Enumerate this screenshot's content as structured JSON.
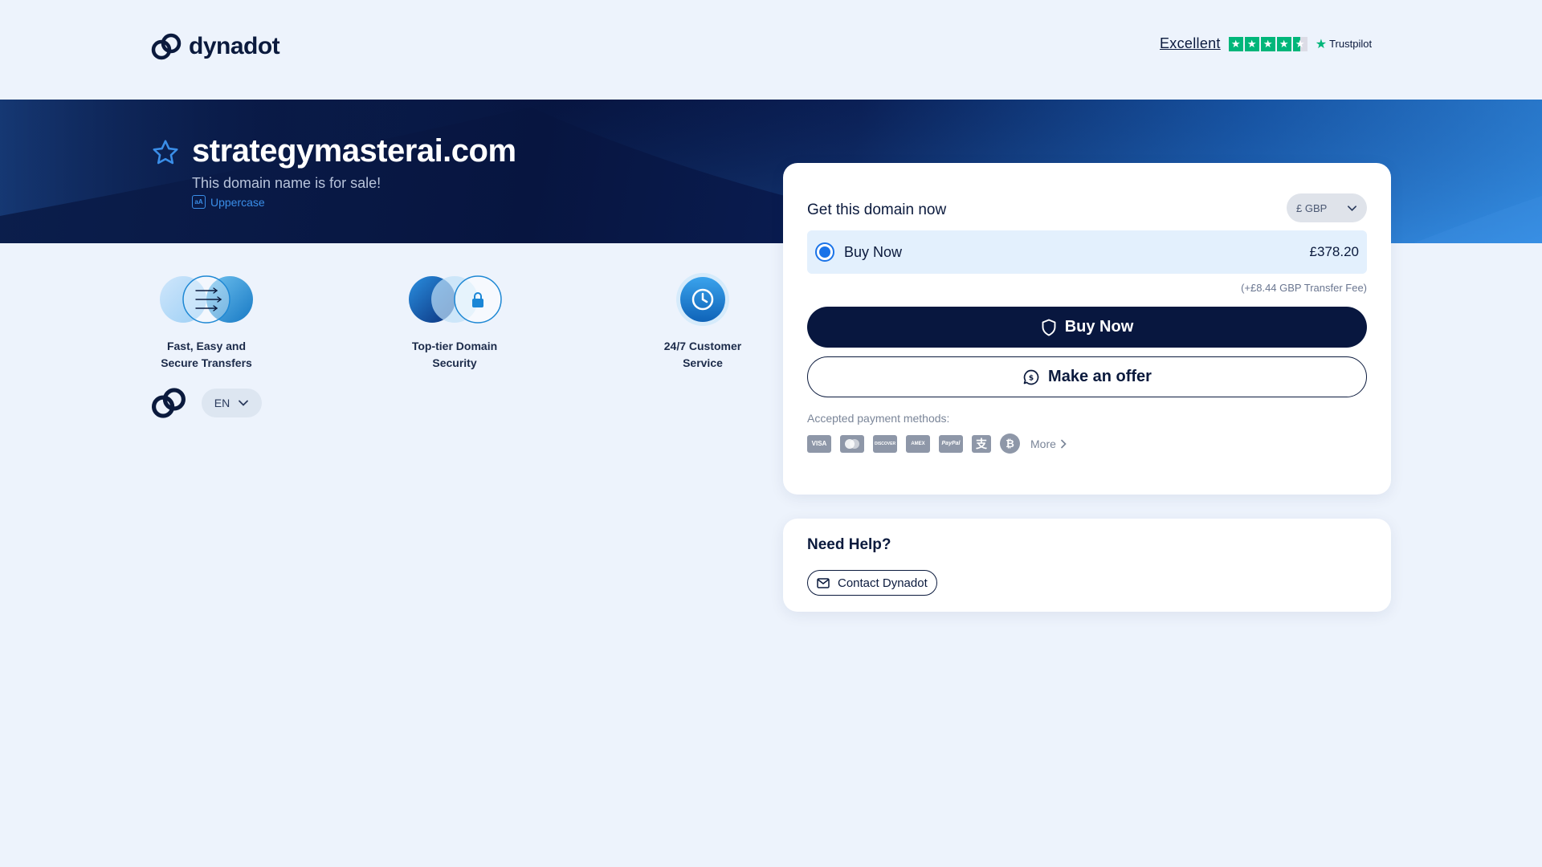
{
  "brand": {
    "name": "dynadot"
  },
  "trustpilot": {
    "rating_word": "Excellent",
    "brand": "Trustpilot",
    "stars": 4.5
  },
  "hero": {
    "domain": "strategymasterai.com",
    "subtitle": "This domain name is for sale!",
    "uppercase_label": "Uppercase",
    "uppercase_icon_text": "aA"
  },
  "features": [
    {
      "line1": "Fast, Easy and",
      "line2": "Secure Transfers",
      "icon": "transfer-icon"
    },
    {
      "line1": "Top-tier Domain",
      "line2": "Security",
      "icon": "lock-icon"
    },
    {
      "line1": "24/7 Customer",
      "line2": "Service",
      "icon": "clock-icon"
    }
  ],
  "language": {
    "selected": "EN"
  },
  "purchase": {
    "title": "Get this domain now",
    "currency": "£ GBP",
    "option_label": "Buy Now",
    "option_price": "£378.20",
    "transfer_fee": "(+£8.44 GBP Transfer Fee)",
    "buy_button": "Buy Now",
    "offer_button": "Make an offer",
    "payment_label": "Accepted payment methods:",
    "payment_methods": [
      "VISA",
      "Mastercard",
      "DISCOVER",
      "American Express",
      "PayPal",
      "Alipay",
      "Bitcoin"
    ],
    "payment_texts": {
      "visa": "VISA",
      "discover": "DISCOVER",
      "amex": "AMEX",
      "paypal": "PayPal",
      "alipay": "支",
      "bitcoin": "₿"
    },
    "more_label": "More"
  },
  "help": {
    "title": "Need Help?",
    "contact_label": "Contact Dynadot"
  },
  "colors": {
    "navy": "#08173f",
    "accent_blue": "#1a73e8",
    "trustpilot_green": "#00b67a",
    "page_bg": "#edf3fc"
  }
}
